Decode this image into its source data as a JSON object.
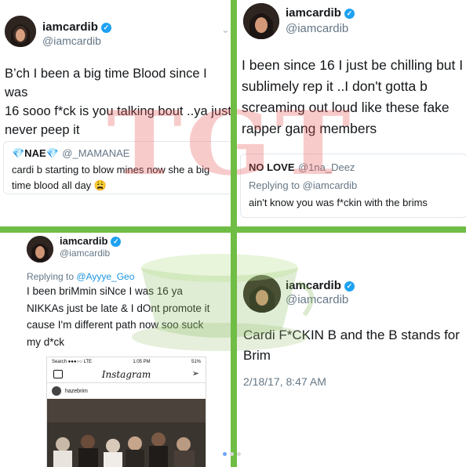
{
  "tweets": {
    "t1": {
      "name": "iamcardib",
      "handle": "@iamcardib",
      "text_l1": "B’ch I been a big time Blood since I was",
      "text_l2": "16 sooo f*ck is you talking bout ..ya just",
      "text_l3": "never peep it",
      "quote": {
        "name": "💎NAE💎",
        "handle": "@_MAMANAE",
        "text_l1": "cardi b starting to blow mines now she a big",
        "text_l2": "time blood all day 😩"
      }
    },
    "t2": {
      "name": "iamcardib",
      "handle": "@iamcardib",
      "text_l1": "I been since 16 I just be chilling but I",
      "text_l2": "sublimely rep it ..I don't gotta b",
      "text_l3": "screaming out loud like these fake",
      "text_l4": "rapper gang members",
      "quote": {
        "name": "NO LOVE",
        "handle": "@1na_Deez",
        "replying_label": "Replying to",
        "replying_handle": "@iamcardib",
        "text": "ain't know you was f*ckin with the brims"
      }
    },
    "t3": {
      "name": "iamcardib",
      "handle": "@iamcardib",
      "replying_label": "Replying to",
      "replying_handle": "@Ayyye_Geo",
      "text_l1": "I been briMmin siNce I was 16 ya",
      "text_l2": "NIKKAs just be late & I dOnt promote it",
      "text_l3": "cause I'm different path now soo suck",
      "text_l4": "my d*ck"
    },
    "t4": {
      "name": "iamcardib",
      "handle": "@iamcardib",
      "text_l1": "Cardi F*CKIN B and the B stands for",
      "text_l2": "Brim",
      "timestamp": "2/18/17, 8:47 AM"
    }
  },
  "instagram": {
    "carrier": "Search ●●●○○ LTE",
    "time": "1:05 PM",
    "battery": "51%",
    "title": "Instagram",
    "username": "hazebrim"
  },
  "watermark": "TGT",
  "colors": {
    "divider": "#6fbd45",
    "verified": "#1da1f2",
    "link": "#1b95e0",
    "watermark": "#e85c5c"
  }
}
